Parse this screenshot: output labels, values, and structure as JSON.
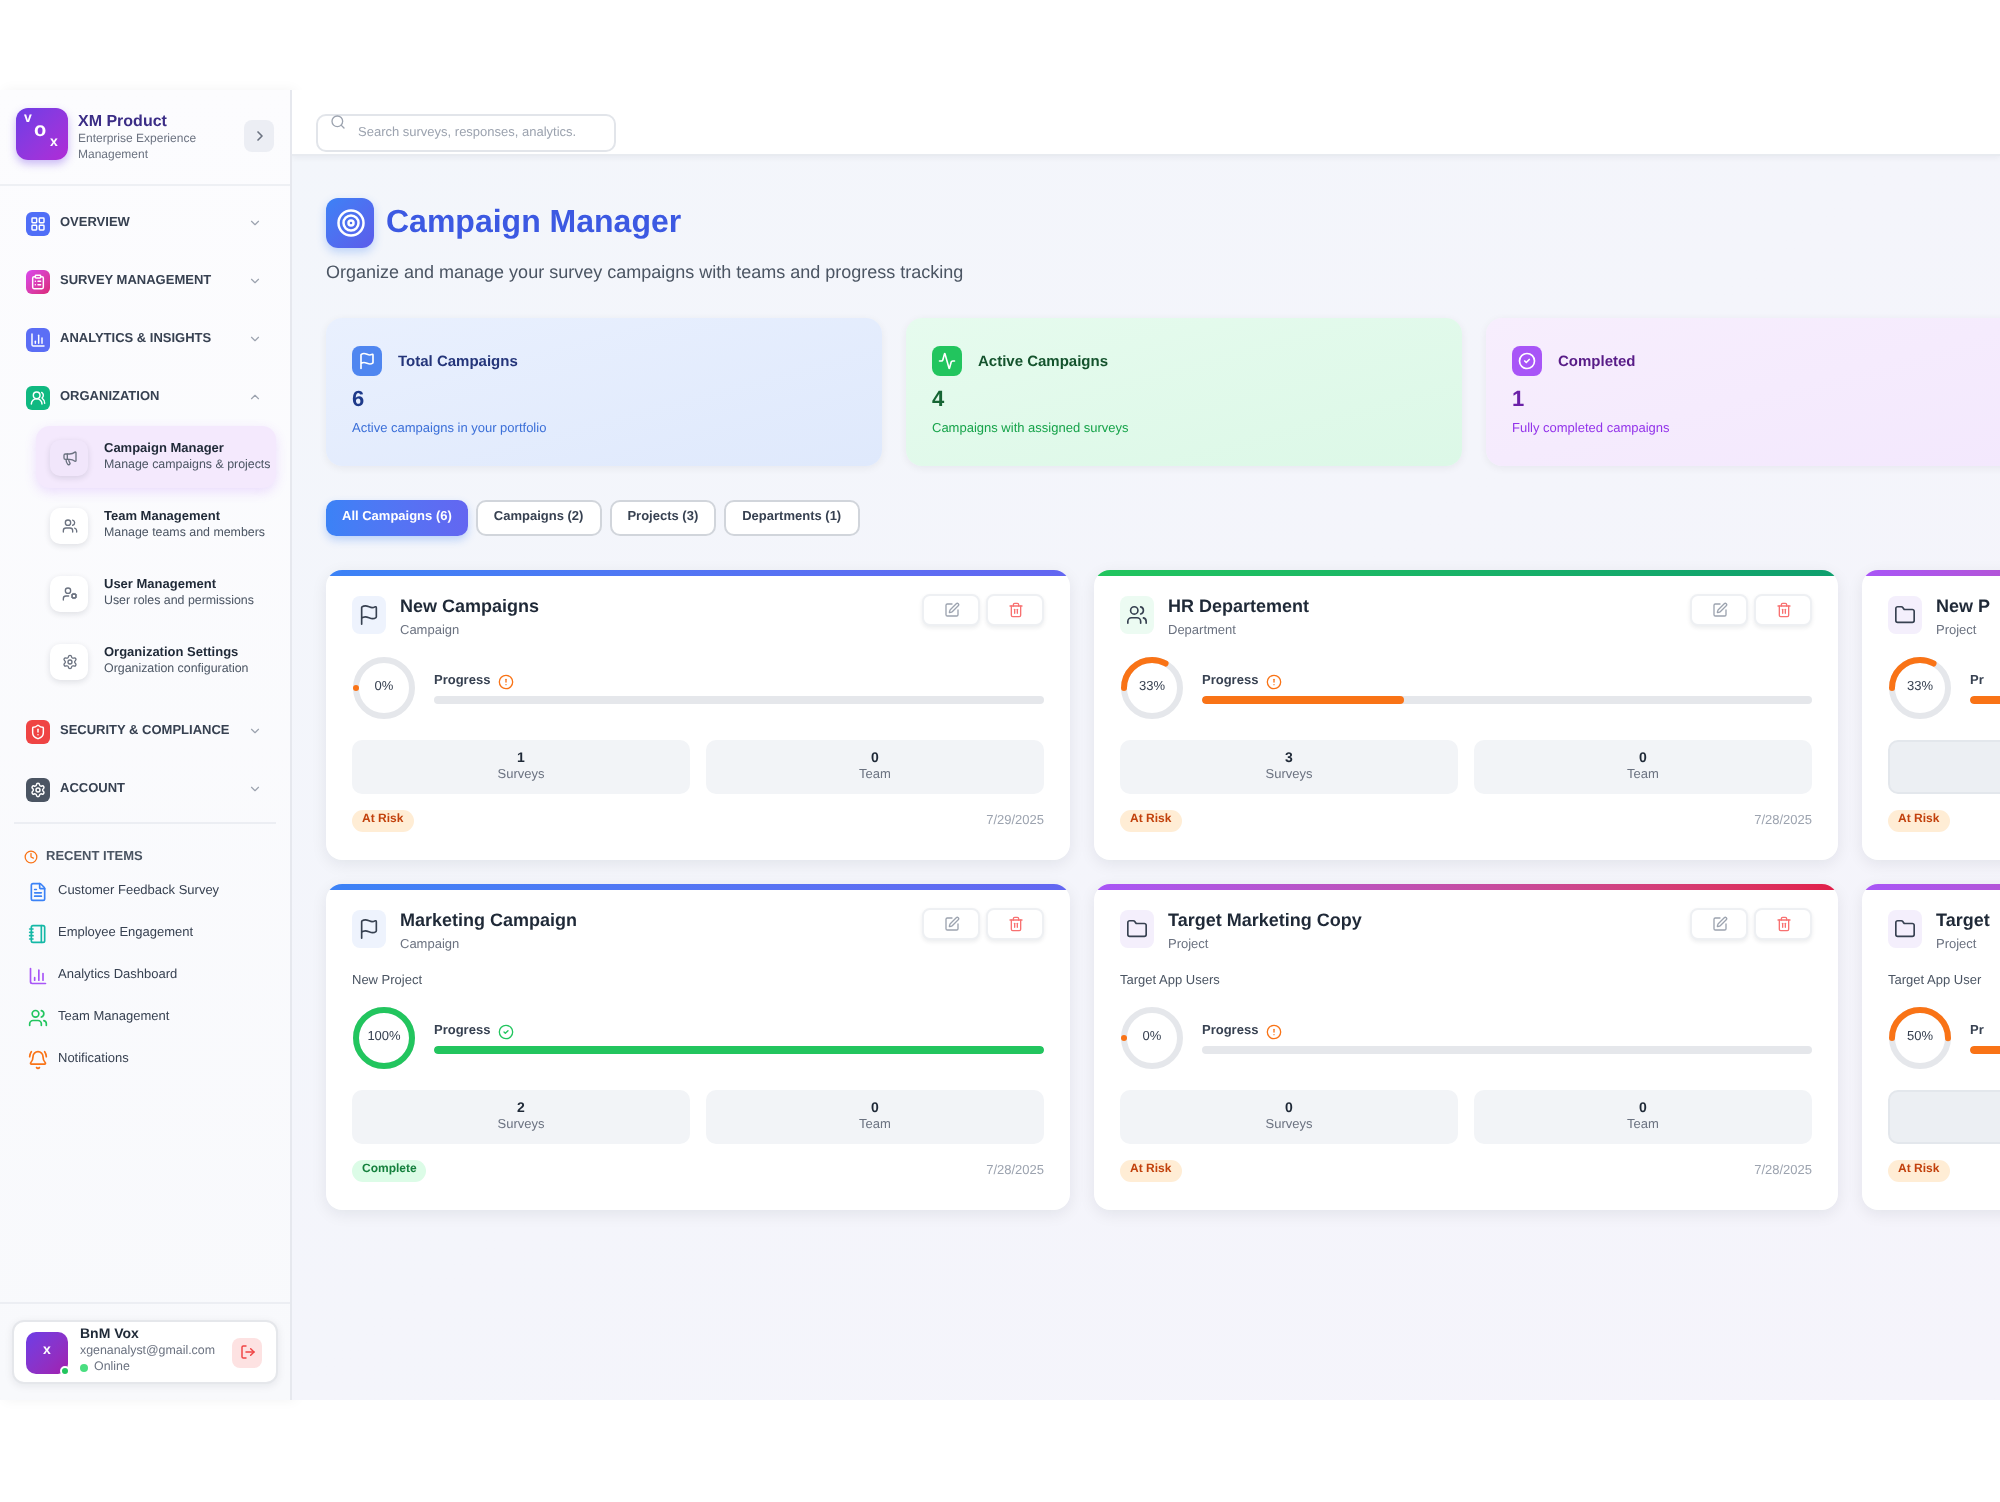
{
  "sidebar": {
    "brand": {
      "logo_letters": [
        "v",
        "o",
        "x"
      ],
      "title": "XM Product",
      "subtitle": "Enterprise Experience Management"
    },
    "sections": [
      {
        "label": "OVERVIEW",
        "expanded": false
      },
      {
        "label": "SURVEY MANAGEMENT",
        "expanded": false
      },
      {
        "label": "ANALYTICS & INSIGHTS",
        "expanded": false
      },
      {
        "label": "ORGANIZATION",
        "expanded": true,
        "children": [
          {
            "title": "Campaign Manager",
            "description": "Manage campaigns & projects",
            "selected": true
          },
          {
            "title": "Team Management",
            "description": "Manage teams and members",
            "selected": false
          },
          {
            "title": "User Management",
            "description": "User roles and permissions",
            "selected": false
          },
          {
            "title": "Organization Settings",
            "description": "Organization configuration",
            "selected": false
          }
        ]
      },
      {
        "label": "SECURITY & COMPLIANCE",
        "expanded": false
      },
      {
        "label": "ACCOUNT",
        "expanded": false
      }
    ],
    "recent": {
      "heading": "RECENT ITEMS",
      "items": [
        "Customer Feedback Survey",
        "Employee Engagement",
        "Analytics Dashboard",
        "Team Management",
        "Notifications"
      ]
    },
    "user": {
      "avatar_letter": "x",
      "name": "BnM Vox",
      "email": "xgenanalyst@gmail.com",
      "status": "Online",
      "online": true
    }
  },
  "topbar": {
    "search": {
      "placeholder": "Search surveys, responses, analytics."
    }
  },
  "page": {
    "title": "Campaign Manager",
    "subtitle": "Organize and manage your survey campaigns with teams and progress tracking"
  },
  "stats": [
    {
      "kind": "total",
      "label": "Total Campaigns",
      "value": "6",
      "description": "Active campaigns in your portfolio"
    },
    {
      "kind": "active",
      "label": "Active Campaigns",
      "value": "4",
      "description": "Campaigns with assigned surveys"
    },
    {
      "kind": "completed",
      "label": "Completed",
      "value": "1",
      "description": "Fully completed campaigns"
    }
  ],
  "filters": [
    {
      "label": "All Campaigns (6)",
      "selected": true
    },
    {
      "label": "Campaigns (2)",
      "selected": false
    },
    {
      "label": "Projects (3)",
      "selected": false
    },
    {
      "label": "Departments (1)",
      "selected": false
    }
  ],
  "cards": [
    {
      "title": "New Campaigns",
      "type": "Campaign",
      "kind": "campaign",
      "clipped": false,
      "progress": {
        "label": "Progress",
        "level": 0,
        "reading": "0%"
      },
      "stats": [
        {
          "value": "1",
          "label": "Surveys"
        },
        {
          "value": "0",
          "label": "Team"
        }
      ],
      "status": {
        "label": "At Risk",
        "kind": "at_risk"
      },
      "date": "7/29/2025"
    },
    {
      "title": "HR Departement",
      "type": "Department",
      "kind": "department",
      "clipped": false,
      "progress": {
        "label": "Progress",
        "level": 0.33,
        "reading": "33%"
      },
      "stats": [
        {
          "value": "3",
          "label": "Surveys"
        },
        {
          "value": "0",
          "label": "Team"
        }
      ],
      "status": {
        "label": "At Risk",
        "kind": "at_risk"
      },
      "date": "7/28/2025"
    },
    {
      "title": "New P",
      "type": "Project",
      "kind": "project",
      "clipped": true,
      "progress": {
        "label": "Pr",
        "level": 0.33,
        "reading": "33%"
      },
      "status": {
        "label": "At Risk",
        "kind": "at_risk"
      }
    },
    {
      "title": "Marketing Campaign",
      "type": "Campaign",
      "kind": "campaign",
      "clipped": false,
      "description": "New Project",
      "progress": {
        "label": "Progress",
        "level": 1,
        "reading": "100%"
      },
      "stats": [
        {
          "value": "2",
          "label": "Surveys"
        },
        {
          "value": "0",
          "label": "Team"
        }
      ],
      "status": {
        "label": "Complete",
        "kind": "complete"
      },
      "date": "7/28/2025"
    },
    {
      "title": "Target Marketing Copy",
      "type": "Project",
      "kind": "project",
      "clipped": false,
      "description": "Target App Users",
      "progress": {
        "label": "Progress",
        "level": 0,
        "reading": "0%"
      },
      "stats": [
        {
          "value": "0",
          "label": "Surveys"
        },
        {
          "value": "0",
          "label": "Team"
        }
      ],
      "status": {
        "label": "At Risk",
        "kind": "at_risk"
      },
      "date": "7/28/2025"
    },
    {
      "title": "Target",
      "type": "Project",
      "kind": "project",
      "clipped": true,
      "description": "Target App User",
      "progress": {
        "label": "Pr",
        "level": 0.5,
        "reading": "50%"
      },
      "status": {
        "label": "At Risk",
        "kind": "at_risk"
      }
    }
  ]
}
